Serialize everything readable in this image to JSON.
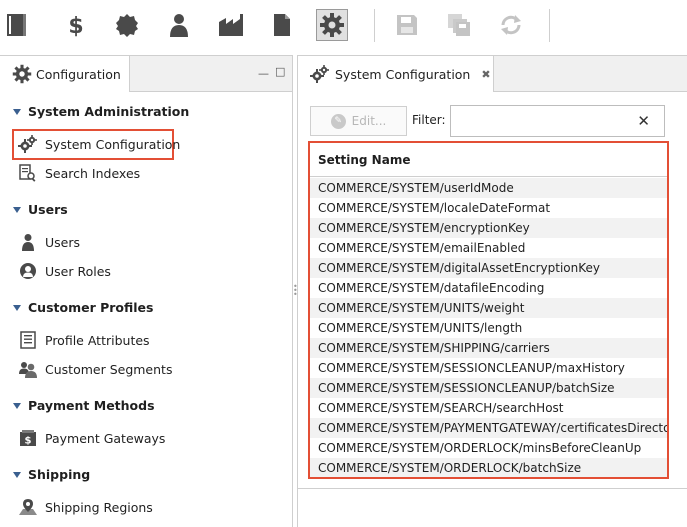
{
  "toolbar": {
    "buttons": [
      {
        "name": "catalog-icon",
        "active": false,
        "disabled": false
      },
      {
        "name": "dollar-icon",
        "active": false,
        "disabled": false
      },
      {
        "name": "badge-icon",
        "active": false,
        "disabled": false
      },
      {
        "name": "user-icon",
        "active": false,
        "disabled": false
      },
      {
        "name": "factory-icon",
        "active": false,
        "disabled": false
      },
      {
        "name": "document-icon",
        "active": false,
        "disabled": false
      },
      {
        "name": "gear-icon",
        "active": true,
        "disabled": false
      },
      {
        "name": "save-icon",
        "active": false,
        "disabled": true
      },
      {
        "name": "save-all-icon",
        "active": false,
        "disabled": true
      },
      {
        "name": "refresh-icon",
        "active": false,
        "disabled": true
      }
    ]
  },
  "left_panel": {
    "tab_label": "Configuration",
    "sections": [
      {
        "title": "System Administration",
        "items": [
          {
            "label": "System Configuration",
            "icon": "gears-icon"
          },
          {
            "label": "Search Indexes",
            "icon": "search-index-icon"
          }
        ]
      },
      {
        "title": "Users",
        "items": [
          {
            "label": "Users",
            "icon": "user-icon"
          },
          {
            "label": "User Roles",
            "icon": "user-role-icon"
          }
        ]
      },
      {
        "title": "Customer Profiles",
        "items": [
          {
            "label": "Profile Attributes",
            "icon": "list-icon"
          },
          {
            "label": "Customer Segments",
            "icon": "group-icon"
          }
        ]
      },
      {
        "title": "Payment Methods",
        "items": [
          {
            "label": "Payment Gateways",
            "icon": "gateway-icon"
          }
        ]
      },
      {
        "title": "Shipping",
        "items": [
          {
            "label": "Shipping Regions",
            "icon": "map-pin-icon"
          }
        ]
      }
    ]
  },
  "right_panel": {
    "tab_label": "System Configuration",
    "edit_label": "Edit...",
    "filter_label": "Filter:",
    "filter_value": "",
    "column_header": "Setting Name",
    "settings": [
      "COMMERCE/SYSTEM/userIdMode",
      "COMMERCE/SYSTEM/localeDateFormat",
      "COMMERCE/SYSTEM/encryptionKey",
      "COMMERCE/SYSTEM/emailEnabled",
      "COMMERCE/SYSTEM/digitalAssetEncryptionKey",
      "COMMERCE/SYSTEM/datafileEncoding",
      "COMMERCE/SYSTEM/UNITS/weight",
      "COMMERCE/SYSTEM/UNITS/length",
      "COMMERCE/SYSTEM/SHIPPING/carriers",
      "COMMERCE/SYSTEM/SESSIONCLEANUP/maxHistory",
      "COMMERCE/SYSTEM/SESSIONCLEANUP/batchSize",
      "COMMERCE/SYSTEM/SEARCH/searchHost",
      "COMMERCE/SYSTEM/PAYMENTGATEWAY/certificatesDirectory",
      "COMMERCE/SYSTEM/ORDERLOCK/minsBeforeCleanUp",
      "COMMERCE/SYSTEM/ORDERLOCK/batchSize"
    ]
  },
  "colors": {
    "highlight": "#e34f35",
    "icon": "#4a4a4a",
    "icon_disabled": "#c4c4c4",
    "caret": "#3a5f8f"
  }
}
